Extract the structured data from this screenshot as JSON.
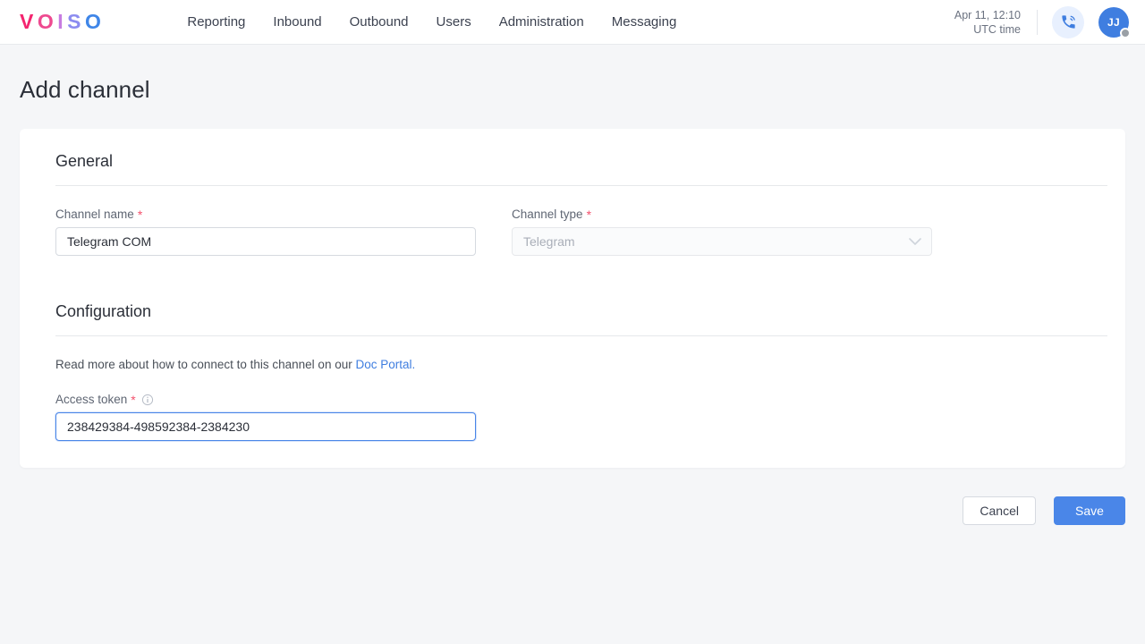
{
  "header": {
    "logo_letters": [
      "V",
      "O",
      "I",
      "S",
      "O"
    ],
    "logo_colors": [
      "#f4256f",
      "#ee4a90",
      "#c77ce0",
      "#8c8cf0",
      "#3f86e8"
    ],
    "nav": [
      {
        "label": "Reporting"
      },
      {
        "label": "Inbound"
      },
      {
        "label": "Outbound"
      },
      {
        "label": "Users"
      },
      {
        "label": "Administration"
      },
      {
        "label": "Messaging"
      }
    ],
    "clock": {
      "datetime": "Apr 11, 12:10",
      "timezone": "UTC time"
    },
    "phone_icon": "phone-call-icon",
    "avatar": {
      "initials": "JJ",
      "background": "#3f7ee0",
      "status_color": "#9aa0a6"
    }
  },
  "page": {
    "title": "Add channel"
  },
  "general": {
    "section_title": "General",
    "channel_name": {
      "label": "Channel name",
      "required_marker": "*",
      "value": "Telegram COM",
      "placeholder": ""
    },
    "channel_type": {
      "label": "Channel type",
      "required_marker": "*",
      "value": "Telegram",
      "icon": "chevron-down-icon",
      "disabled": true
    }
  },
  "configuration": {
    "section_title": "Configuration",
    "help_prefix": "Read more about how to connect to this channel on our ",
    "help_link": "Doc Portal.",
    "help_link_color": "#3f7ee0",
    "access_token": {
      "label": "Access token",
      "required_marker": "*",
      "info_icon": "info-circle-icon",
      "value": "238429384-498592384-2384230",
      "placeholder": "",
      "focused": true
    }
  },
  "footer": {
    "cancel_label": "Cancel",
    "save_label": "Save",
    "save_color": "#4a86e8"
  }
}
